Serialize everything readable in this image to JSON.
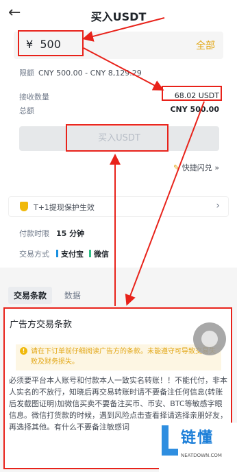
{
  "header": {
    "title": "买入USDT",
    "back_icon": "arrow-left-icon"
  },
  "amount": {
    "currency": "¥",
    "value": "500",
    "all_label": "全部"
  },
  "limit": {
    "label": "限额",
    "value": "CNY 500.00 - CNY 8,129.29"
  },
  "receive": {
    "label": "接收数量",
    "value": "68.02 USDT"
  },
  "total": {
    "label": "总额",
    "value": "CNY 500.00"
  },
  "buy_button": "买入USDT",
  "quick": {
    "icon": "pen-icon",
    "label": "快捷闪兑",
    "suffix": "»"
  },
  "protect": {
    "icon": "shield-icon",
    "label": "T+1提现保护生效",
    "chevron_icon": "chevron-right-icon"
  },
  "pay_time": {
    "label": "付款时限",
    "value": "15 分钟"
  },
  "pay_method": {
    "label": "交易方式",
    "methods": [
      "支付宝",
      "微信"
    ]
  },
  "tabs": [
    "交易条款",
    "数据"
  ],
  "terms": {
    "title": "广告方交易条款",
    "warning": "请在下订单前仔细阅读广告方的条款。未能遵守可导致交易失败及财务损失。",
    "body": "必须要平台本人账号和付款本人一致实名转账！！不能代付，非本人实名的不放行，知晓后再交易转账时请不要备注任何信息(转账后发截图证明)加微信买卖不要备注买币、币安、BTC等敏感字眼信息。微信打货款的时候，遇到风险点击查看择请选择亲朋好友，再选择其他。有什么不要备注敏感词"
  },
  "watermark": {
    "cn": "链懂",
    "en": "NEATDOWN.COM"
  },
  "colors": {
    "accent": "#e2a613",
    "annotation": "#e8221a",
    "alipay": "#1a90e0",
    "wechat": "#2ebd85"
  }
}
